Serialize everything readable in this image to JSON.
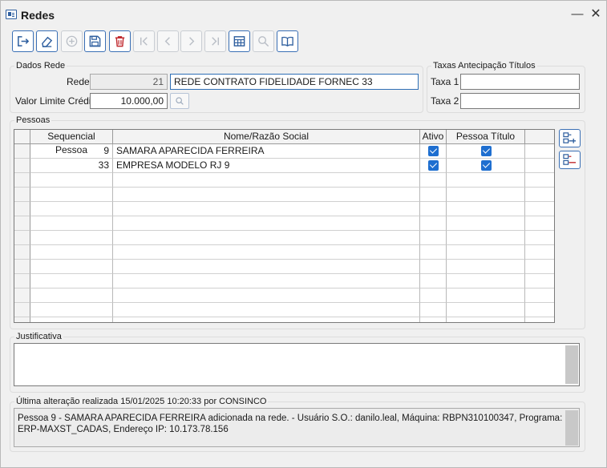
{
  "window": {
    "title": "Redes"
  },
  "toolbar": {
    "buttons": [
      {
        "name": "exit-button",
        "icon": "exit-icon",
        "state": "active"
      },
      {
        "name": "clear-button",
        "icon": "eraser-icon",
        "state": "active"
      },
      {
        "name": "add-button",
        "icon": "plus-circle-icon",
        "state": "disabled"
      },
      {
        "name": "save-button",
        "icon": "floppy-icon",
        "state": "active"
      },
      {
        "name": "delete-button",
        "icon": "trash-icon",
        "state": "active"
      },
      {
        "name": "first-button",
        "icon": "first-icon",
        "state": "disabled"
      },
      {
        "name": "prev-button",
        "icon": "prev-icon",
        "state": "disabled"
      },
      {
        "name": "next-button",
        "icon": "next-icon",
        "state": "disabled"
      },
      {
        "name": "last-button",
        "icon": "last-icon",
        "state": "disabled"
      },
      {
        "name": "grid-button",
        "icon": "table-icon",
        "state": "active"
      },
      {
        "name": "search-button",
        "icon": "magnifier-icon",
        "state": "disabled"
      },
      {
        "name": "help-button",
        "icon": "book-icon",
        "state": "active"
      }
    ]
  },
  "dados_rede": {
    "group_label": "Dados Rede",
    "rede_label": "Rede",
    "rede_code": "21",
    "rede_name": "REDE CONTRATO FIDELIDADE FORNEC 33",
    "limite_label": "Valor Limite Crédito",
    "limite_value": "10.000,00"
  },
  "taxas": {
    "group_label": "Taxas Antecipação Títulos",
    "taxa1_label": "Taxa 1",
    "taxa1_value": "",
    "taxa2_label": "Taxa 2",
    "taxa2_value": ""
  },
  "pessoas": {
    "group_label": "Pessoas",
    "columns": [
      "Sequencial Pessoa",
      "Nome/Razão Social",
      "Ativo",
      "Pessoa Título"
    ],
    "rows": [
      {
        "seq": "9",
        "nome": "SAMARA APARECIDA FERREIRA",
        "ativo": true,
        "pessoa_titulo": true
      },
      {
        "seq": "33",
        "nome": "EMPRESA MODELO RJ 9",
        "ativo": true,
        "pessoa_titulo": true
      }
    ]
  },
  "justificativa": {
    "group_label": "Justificativa",
    "value": ""
  },
  "ultima_alteracao": {
    "group_label": "Última alteração realizada 15/01/2025 10:20:33 por CONSINCO",
    "text": "Pessoa 9 - SAMARA APARECIDA FERREIRA adicionada na rede.  - Usuário S.O.: danilo.leal, Máquina: RBPN310100347, Programa: ERP-MAXST_CADAS, Endereço IP: 10.173.78.156"
  },
  "colors": {
    "accent": "#1f6fd0",
    "delete": "#c0282d",
    "nav": "#2f5f9f"
  }
}
